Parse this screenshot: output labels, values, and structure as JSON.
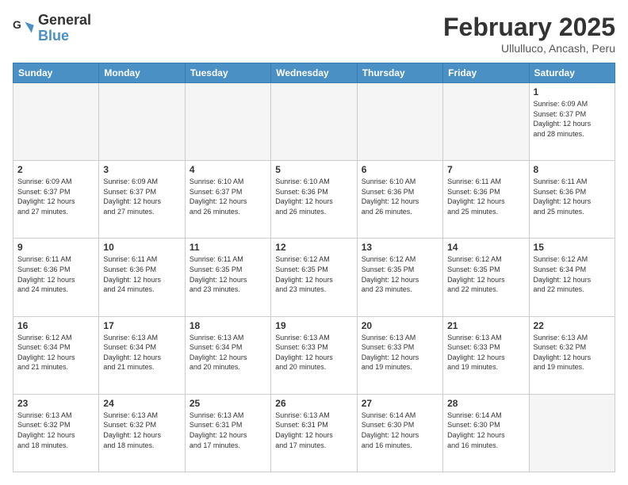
{
  "header": {
    "logo_general": "General",
    "logo_blue": "Blue",
    "month_title": "February 2025",
    "subtitle": "Ullulluco, Ancash, Peru"
  },
  "weekdays": [
    "Sunday",
    "Monday",
    "Tuesday",
    "Wednesday",
    "Thursday",
    "Friday",
    "Saturday"
  ],
  "weeks": [
    [
      {
        "day": "",
        "info": ""
      },
      {
        "day": "",
        "info": ""
      },
      {
        "day": "",
        "info": ""
      },
      {
        "day": "",
        "info": ""
      },
      {
        "day": "",
        "info": ""
      },
      {
        "day": "",
        "info": ""
      },
      {
        "day": "1",
        "info": "Sunrise: 6:09 AM\nSunset: 6:37 PM\nDaylight: 12 hours\nand 28 minutes."
      }
    ],
    [
      {
        "day": "2",
        "info": "Sunrise: 6:09 AM\nSunset: 6:37 PM\nDaylight: 12 hours\nand 27 minutes."
      },
      {
        "day": "3",
        "info": "Sunrise: 6:09 AM\nSunset: 6:37 PM\nDaylight: 12 hours\nand 27 minutes."
      },
      {
        "day": "4",
        "info": "Sunrise: 6:10 AM\nSunset: 6:37 PM\nDaylight: 12 hours\nand 26 minutes."
      },
      {
        "day": "5",
        "info": "Sunrise: 6:10 AM\nSunset: 6:36 PM\nDaylight: 12 hours\nand 26 minutes."
      },
      {
        "day": "6",
        "info": "Sunrise: 6:10 AM\nSunset: 6:36 PM\nDaylight: 12 hours\nand 26 minutes."
      },
      {
        "day": "7",
        "info": "Sunrise: 6:11 AM\nSunset: 6:36 PM\nDaylight: 12 hours\nand 25 minutes."
      },
      {
        "day": "8",
        "info": "Sunrise: 6:11 AM\nSunset: 6:36 PM\nDaylight: 12 hours\nand 25 minutes."
      }
    ],
    [
      {
        "day": "9",
        "info": "Sunrise: 6:11 AM\nSunset: 6:36 PM\nDaylight: 12 hours\nand 24 minutes."
      },
      {
        "day": "10",
        "info": "Sunrise: 6:11 AM\nSunset: 6:36 PM\nDaylight: 12 hours\nand 24 minutes."
      },
      {
        "day": "11",
        "info": "Sunrise: 6:11 AM\nSunset: 6:35 PM\nDaylight: 12 hours\nand 23 minutes."
      },
      {
        "day": "12",
        "info": "Sunrise: 6:12 AM\nSunset: 6:35 PM\nDaylight: 12 hours\nand 23 minutes."
      },
      {
        "day": "13",
        "info": "Sunrise: 6:12 AM\nSunset: 6:35 PM\nDaylight: 12 hours\nand 23 minutes."
      },
      {
        "day": "14",
        "info": "Sunrise: 6:12 AM\nSunset: 6:35 PM\nDaylight: 12 hours\nand 22 minutes."
      },
      {
        "day": "15",
        "info": "Sunrise: 6:12 AM\nSunset: 6:34 PM\nDaylight: 12 hours\nand 22 minutes."
      }
    ],
    [
      {
        "day": "16",
        "info": "Sunrise: 6:12 AM\nSunset: 6:34 PM\nDaylight: 12 hours\nand 21 minutes."
      },
      {
        "day": "17",
        "info": "Sunrise: 6:13 AM\nSunset: 6:34 PM\nDaylight: 12 hours\nand 21 minutes."
      },
      {
        "day": "18",
        "info": "Sunrise: 6:13 AM\nSunset: 6:34 PM\nDaylight: 12 hours\nand 20 minutes."
      },
      {
        "day": "19",
        "info": "Sunrise: 6:13 AM\nSunset: 6:33 PM\nDaylight: 12 hours\nand 20 minutes."
      },
      {
        "day": "20",
        "info": "Sunrise: 6:13 AM\nSunset: 6:33 PM\nDaylight: 12 hours\nand 19 minutes."
      },
      {
        "day": "21",
        "info": "Sunrise: 6:13 AM\nSunset: 6:33 PM\nDaylight: 12 hours\nand 19 minutes."
      },
      {
        "day": "22",
        "info": "Sunrise: 6:13 AM\nSunset: 6:32 PM\nDaylight: 12 hours\nand 19 minutes."
      }
    ],
    [
      {
        "day": "23",
        "info": "Sunrise: 6:13 AM\nSunset: 6:32 PM\nDaylight: 12 hours\nand 18 minutes."
      },
      {
        "day": "24",
        "info": "Sunrise: 6:13 AM\nSunset: 6:32 PM\nDaylight: 12 hours\nand 18 minutes."
      },
      {
        "day": "25",
        "info": "Sunrise: 6:13 AM\nSunset: 6:31 PM\nDaylight: 12 hours\nand 17 minutes."
      },
      {
        "day": "26",
        "info": "Sunrise: 6:13 AM\nSunset: 6:31 PM\nDaylight: 12 hours\nand 17 minutes."
      },
      {
        "day": "27",
        "info": "Sunrise: 6:14 AM\nSunset: 6:30 PM\nDaylight: 12 hours\nand 16 minutes."
      },
      {
        "day": "28",
        "info": "Sunrise: 6:14 AM\nSunset: 6:30 PM\nDaylight: 12 hours\nand 16 minutes."
      },
      {
        "day": "",
        "info": ""
      }
    ]
  ]
}
